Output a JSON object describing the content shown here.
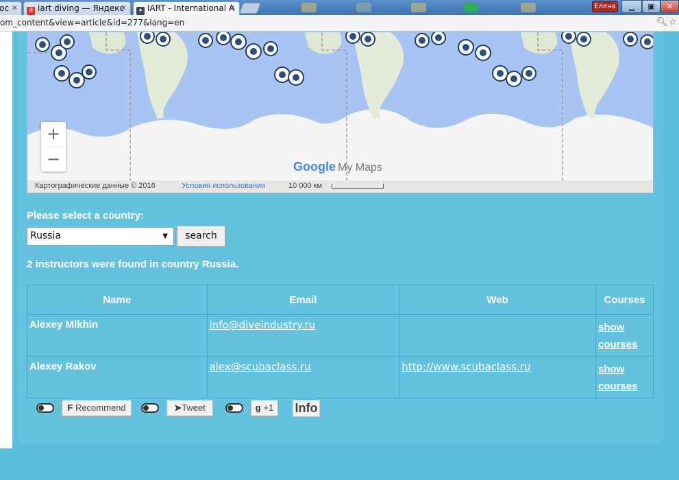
{
  "browser": {
    "tabs": [
      {
        "favicon": "doc-icon",
        "label": "ос"
      },
      {
        "favicon": "yandex-icon",
        "label": "iart diving — Яндекс"
      },
      {
        "favicon": "iart-icon",
        "label": "IART - International A"
      }
    ],
    "user_badge": "Елена",
    "url": "om_content&view=article&id=277&lang=en"
  },
  "map": {
    "zoom_in": "+",
    "zoom_out": "−",
    "brand_google": "Google",
    "brand_mymaps": "My Maps",
    "attribution": "Картографические данные © 2016",
    "terms": "Условия использования",
    "scale": "10 000 км"
  },
  "form": {
    "label": "Please select a country:",
    "selected_country": "Russia",
    "search_button": "search"
  },
  "results": {
    "summary": "2 instructors were found in country Russia.",
    "headers": [
      "Name",
      "Email",
      "Web",
      "Courses"
    ],
    "rows": [
      {
        "name": "Alexey Mikhin",
        "email": "info@diveindustry.ru",
        "web": "",
        "courses_line1": "show",
        "courses_line2": "courses"
      },
      {
        "name": "Alexey Rakov",
        "email": "alex@scubaclass.ru",
        "web": "http://www.scubaclass.ru",
        "courses_line1": "show",
        "courses_line2": "courses"
      }
    ]
  },
  "social": {
    "recommend": "Recommend",
    "tweet": "Tweet",
    "gplus": "+1",
    "info": "Info"
  },
  "colors": {
    "page_bg": "#5bbfdc",
    "panel_bg": "#65c2df",
    "map_water": "#a7c4f2"
  }
}
